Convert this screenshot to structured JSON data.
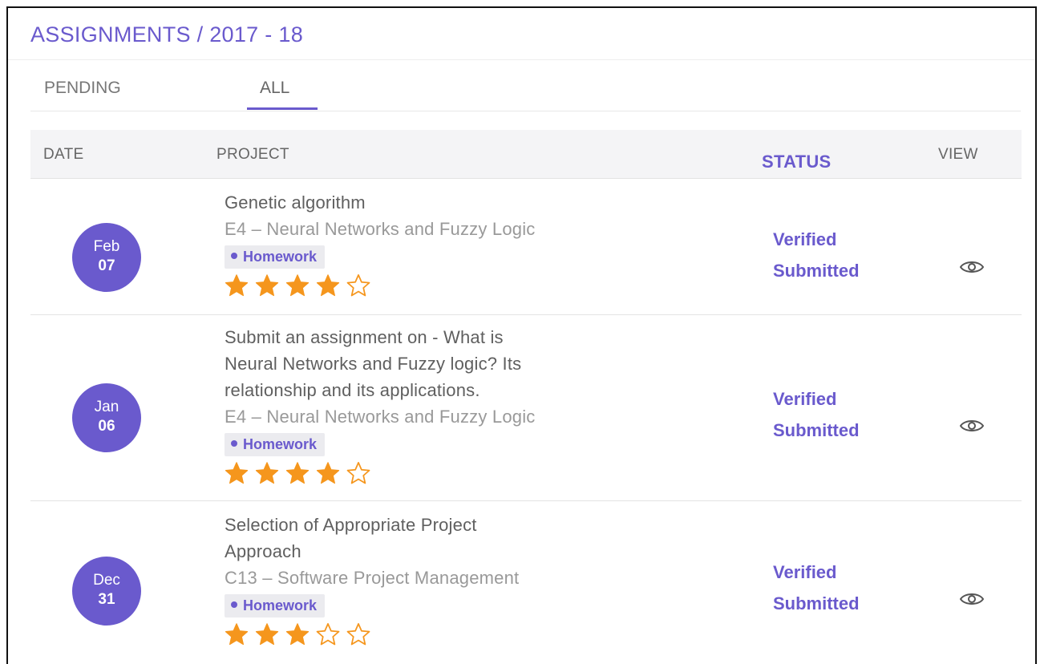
{
  "header": {
    "title": "ASSIGNMENTS / 2017 - 18"
  },
  "tabs": [
    {
      "label": "PENDING",
      "active": false
    },
    {
      "label": "ALL",
      "active": true
    }
  ],
  "table": {
    "columns": {
      "date": "DATE",
      "project": "PROJECT",
      "status": "STATUS",
      "view": "VIEW"
    },
    "rows": [
      {
        "month": "Feb",
        "day": "07",
        "title_lines": [
          "Genetic algorithm"
        ],
        "course": "E4 – Neural Networks and Fuzzy Logic",
        "tag": "Homework",
        "rating": 4,
        "rating_max": 5,
        "status_1": "Verified",
        "status_2": "Submitted",
        "view_icon": "eye-icon"
      },
      {
        "month": "Jan",
        "day": "06",
        "title_lines": [
          "Submit an assignment on - What is",
          "Neural Networks and Fuzzy logic? Its",
          "relationship and its applications."
        ],
        "course": "E4 – Neural Networks and Fuzzy Logic",
        "tag": "Homework",
        "rating": 4,
        "rating_max": 5,
        "status_1": "Verified",
        "status_2": "Submitted",
        "view_icon": "eye-icon"
      },
      {
        "month": "Dec",
        "day": "31",
        "title_lines": [
          "Selection of Appropriate Project",
          "Approach"
        ],
        "course": "C13 – Software Project Management",
        "tag": "Homework",
        "rating": 3,
        "rating_max": 5,
        "status_1": "Verified",
        "status_2": "Submitted",
        "view_icon": "eye-icon"
      }
    ]
  },
  "colors": {
    "accent": "#6a5acd",
    "star_filled": "#f5961d",
    "star_empty": "#f5961d"
  }
}
